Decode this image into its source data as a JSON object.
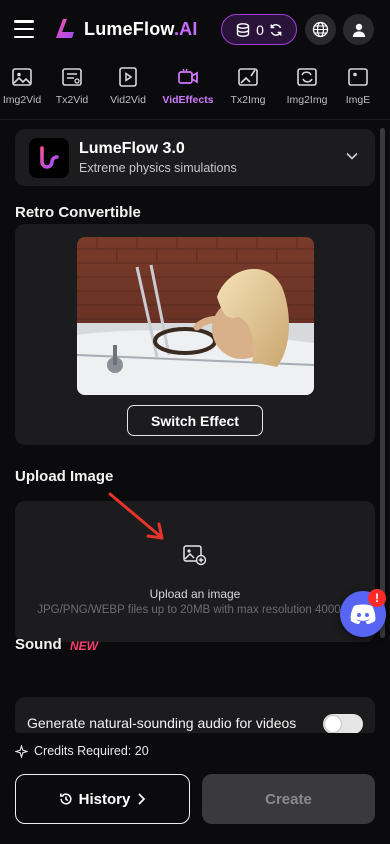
{
  "header": {
    "brand_main": "LumeFlow",
    "brand_suffix": ".AI",
    "credits_value": "0",
    "menu_icon": "hamburger-icon",
    "credits_icon": "coins-stack-icon",
    "refresh_icon": "refresh-icon",
    "language_icon": "globe-icon",
    "user_icon": "user-icon"
  },
  "tabs": [
    {
      "label": "Img2Vid",
      "icon": "image-icon",
      "active": false
    },
    {
      "label": "Tx2Vid",
      "icon": "text-doc-icon",
      "active": false
    },
    {
      "label": "Vid2Vid",
      "icon": "video-play-icon",
      "active": false
    },
    {
      "label": "VidEffects",
      "icon": "video-camera-icon",
      "active": true
    },
    {
      "label": "Tx2Img",
      "icon": "image-pen-icon",
      "active": false
    },
    {
      "label": "Img2Img",
      "icon": "image-convert-icon",
      "active": false
    },
    {
      "label": "ImgE",
      "icon": "image-icon",
      "active": false
    }
  ],
  "model": {
    "name": "LumeFlow 3.0",
    "description": "Extreme physics simulations"
  },
  "effect": {
    "title": "Retro Convertible",
    "switch_label": "Switch Effect"
  },
  "upload": {
    "section_title": "Upload Image",
    "title": "Upload an image",
    "hint": "JPG/PNG/WEBP files up to 20MB with max resolution 4000px"
  },
  "sound": {
    "section_title": "Sound",
    "badge": "NEW",
    "toggle_label": "Generate natural-sounding audio for videos"
  },
  "footer": {
    "credits_required": "Credits Required: 20",
    "history_label": "History",
    "create_label": "Create"
  },
  "discord": {
    "badge": "!"
  },
  "colors": {
    "accent": "#c86cff",
    "active_tab": "#d178ff",
    "new_badge": "#ff3d6e",
    "discord": "#5865f2"
  }
}
